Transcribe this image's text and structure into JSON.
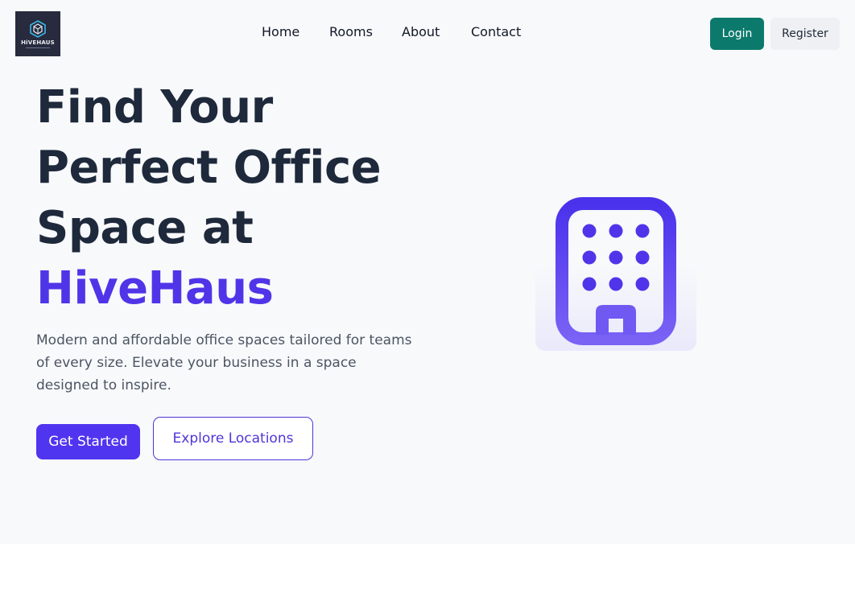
{
  "brand": {
    "logo_text": "HiVEHAUS",
    "logo_icon": "hexagon-cube-icon"
  },
  "nav": {
    "items": [
      {
        "label": "Home"
      },
      {
        "label": "Rooms"
      },
      {
        "label": "About"
      },
      {
        "label": "Contact"
      }
    ]
  },
  "auth": {
    "login_label": "Login",
    "register_label": "Register"
  },
  "hero": {
    "headline_line1": "Find Your",
    "headline_line2": "Perfect Office",
    "headline_line3": "Space at",
    "headline_brand": "HiveHaus",
    "subtext": "Modern and affordable office spaces tailored for teams of every size. Elevate your business in a space designed to inspire.",
    "primary_cta": "Get Started",
    "secondary_cta": "Explore Locations",
    "illustration_icon": "office-building-icon"
  },
  "colors": {
    "accent": "#4f35ef",
    "login_button": "#0b7a6c",
    "heading": "#1e293b",
    "hero_background": "#f8f9fb"
  }
}
